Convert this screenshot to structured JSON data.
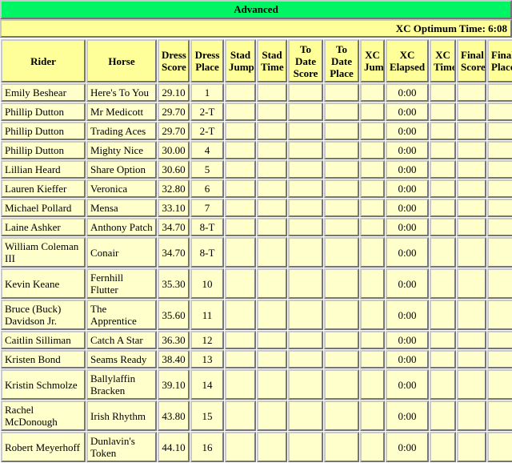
{
  "banner": {
    "title": "Advanced",
    "optimum_time_label": "XC Optimum Time: 6:08",
    "title_bg": "#00F565",
    "subbanner_bg": "#FFFF99"
  },
  "table": {
    "headers": [
      "Rider",
      "Horse",
      "Dress Score",
      "Dress Place",
      "Stad Jump",
      "Stad Time",
      "To Date Score",
      "To Date Place",
      "XC Jump",
      "XC Elapsed",
      "XC Time",
      "Final Score",
      "Final Place"
    ],
    "rows": [
      {
        "rider": "Emily Beshear",
        "horse": "Here's To You",
        "dress_score": "29.10",
        "dress_place": "1",
        "stad_jump": "",
        "stad_time": "",
        "to_date_score": "",
        "to_date_place": "",
        "xc_jump": "",
        "xc_elapsed": "0:00",
        "xc_time": "",
        "final_score": "",
        "final_place": ""
      },
      {
        "rider": "Phillip Dutton",
        "horse": "Mr Medicott",
        "dress_score": "29.70",
        "dress_place": "2-T",
        "stad_jump": "",
        "stad_time": "",
        "to_date_score": "",
        "to_date_place": "",
        "xc_jump": "",
        "xc_elapsed": "0:00",
        "xc_time": "",
        "final_score": "",
        "final_place": ""
      },
      {
        "rider": "Phillip Dutton",
        "horse": "Trading Aces",
        "dress_score": "29.70",
        "dress_place": "2-T",
        "stad_jump": "",
        "stad_time": "",
        "to_date_score": "",
        "to_date_place": "",
        "xc_jump": "",
        "xc_elapsed": "0:00",
        "xc_time": "",
        "final_score": "",
        "final_place": ""
      },
      {
        "rider": "Phillip Dutton",
        "horse": "Mighty Nice",
        "dress_score": "30.00",
        "dress_place": "4",
        "stad_jump": "",
        "stad_time": "",
        "to_date_score": "",
        "to_date_place": "",
        "xc_jump": "",
        "xc_elapsed": "0:00",
        "xc_time": "",
        "final_score": "",
        "final_place": ""
      },
      {
        "rider": "Lillian Heard",
        "horse": "Share Option",
        "dress_score": "30.60",
        "dress_place": "5",
        "stad_jump": "",
        "stad_time": "",
        "to_date_score": "",
        "to_date_place": "",
        "xc_jump": "",
        "xc_elapsed": "0:00",
        "xc_time": "",
        "final_score": "",
        "final_place": ""
      },
      {
        "rider": "Lauren Kieffer",
        "horse": "Veronica",
        "dress_score": "32.80",
        "dress_place": "6",
        "stad_jump": "",
        "stad_time": "",
        "to_date_score": "",
        "to_date_place": "",
        "xc_jump": "",
        "xc_elapsed": "0:00",
        "xc_time": "",
        "final_score": "",
        "final_place": ""
      },
      {
        "rider": "Michael Pollard",
        "horse": "Mensa",
        "dress_score": "33.10",
        "dress_place": "7",
        "stad_jump": "",
        "stad_time": "",
        "to_date_score": "",
        "to_date_place": "",
        "xc_jump": "",
        "xc_elapsed": "0:00",
        "xc_time": "",
        "final_score": "",
        "final_place": ""
      },
      {
        "rider": "Laine Ashker",
        "horse": "Anthony Patch",
        "dress_score": "34.70",
        "dress_place": "8-T",
        "stad_jump": "",
        "stad_time": "",
        "to_date_score": "",
        "to_date_place": "",
        "xc_jump": "",
        "xc_elapsed": "0:00",
        "xc_time": "",
        "final_score": "",
        "final_place": ""
      },
      {
        "rider": "William Coleman III",
        "horse": "Conair",
        "dress_score": "34.70",
        "dress_place": "8-T",
        "stad_jump": "",
        "stad_time": "",
        "to_date_score": "",
        "to_date_place": "",
        "xc_jump": "",
        "xc_elapsed": "0:00",
        "xc_time": "",
        "final_score": "",
        "final_place": ""
      },
      {
        "rider": "Kevin Keane",
        "horse": "Fernhill Flutter",
        "dress_score": "35.30",
        "dress_place": "10",
        "stad_jump": "",
        "stad_time": "",
        "to_date_score": "",
        "to_date_place": "",
        "xc_jump": "",
        "xc_elapsed": "0:00",
        "xc_time": "",
        "final_score": "",
        "final_place": ""
      },
      {
        "rider": "Bruce (Buck) Davidson Jr.",
        "horse": "The Apprentice",
        "dress_score": "35.60",
        "dress_place": "11",
        "stad_jump": "",
        "stad_time": "",
        "to_date_score": "",
        "to_date_place": "",
        "xc_jump": "",
        "xc_elapsed": "0:00",
        "xc_time": "",
        "final_score": "",
        "final_place": ""
      },
      {
        "rider": "Caitlin Silliman",
        "horse": "Catch A Star",
        "dress_score": "36.30",
        "dress_place": "12",
        "stad_jump": "",
        "stad_time": "",
        "to_date_score": "",
        "to_date_place": "",
        "xc_jump": "",
        "xc_elapsed": "0:00",
        "xc_time": "",
        "final_score": "",
        "final_place": ""
      },
      {
        "rider": "Kristen Bond",
        "horse": "Seams Ready",
        "dress_score": "38.40",
        "dress_place": "13",
        "stad_jump": "",
        "stad_time": "",
        "to_date_score": "",
        "to_date_place": "",
        "xc_jump": "",
        "xc_elapsed": "0:00",
        "xc_time": "",
        "final_score": "",
        "final_place": ""
      },
      {
        "rider": "Kristin Schmolze",
        "horse": "Ballylaffin Bracken",
        "dress_score": "39.10",
        "dress_place": "14",
        "stad_jump": "",
        "stad_time": "",
        "to_date_score": "",
        "to_date_place": "",
        "xc_jump": "",
        "xc_elapsed": "0:00",
        "xc_time": "",
        "final_score": "",
        "final_place": ""
      },
      {
        "rider": "Rachel McDonough",
        "horse": "Irish Rhythm",
        "dress_score": "43.80",
        "dress_place": "15",
        "stad_jump": "",
        "stad_time": "",
        "to_date_score": "",
        "to_date_place": "",
        "xc_jump": "",
        "xc_elapsed": "0:00",
        "xc_time": "",
        "final_score": "",
        "final_place": ""
      },
      {
        "rider": "Robert Meyerhoff",
        "horse": "Dunlavin's Token",
        "dress_score": "44.10",
        "dress_place": "16",
        "stad_jump": "",
        "stad_time": "",
        "to_date_score": "",
        "to_date_place": "",
        "xc_jump": "",
        "xc_elapsed": "0:00",
        "xc_time": "",
        "final_score": "",
        "final_place": ""
      }
    ]
  }
}
